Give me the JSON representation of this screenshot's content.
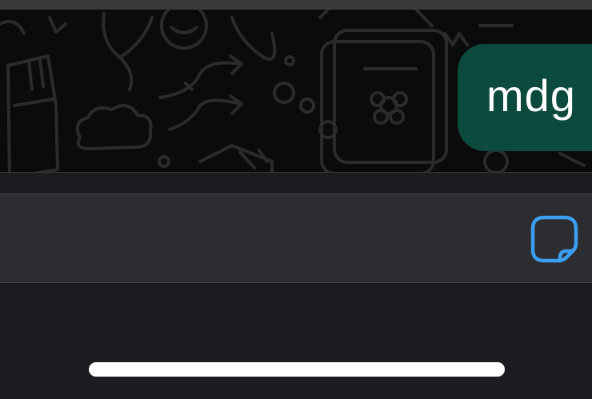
{
  "chat": {
    "outgoing_message": "mdg"
  },
  "composer": {
    "input_value": "",
    "input_placeholder": "",
    "sticker_icon": "sticker-icon"
  },
  "colors": {
    "bubble": "#0c4a3d",
    "accent": "#3a9ff2",
    "background": "#1c1b1f",
    "input_background": "#2d2c30"
  }
}
